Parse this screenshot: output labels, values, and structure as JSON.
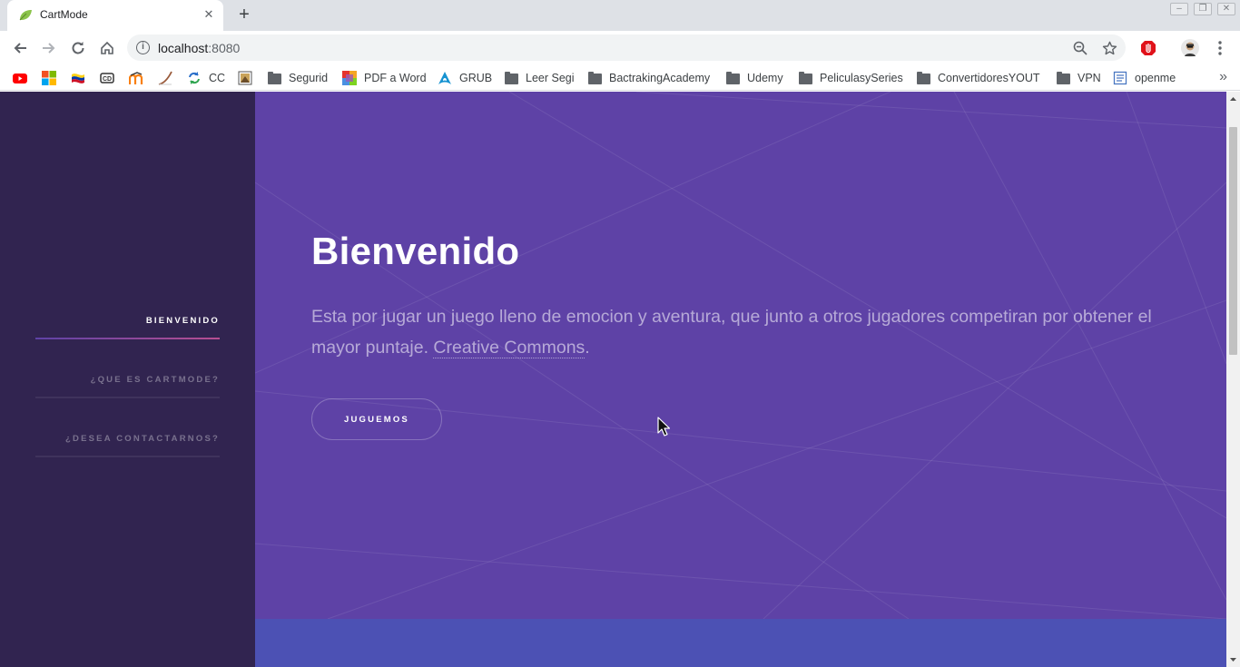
{
  "browser": {
    "tab_title": "CartMode",
    "tab_close": "✕",
    "new_tab": "+",
    "url_host": "localhost",
    "url_port": ":8080",
    "icons": {
      "back": "arrow-left-icon",
      "forward": "arrow-right-icon",
      "reload": "reload-icon",
      "home": "home-icon",
      "zoom": "zoom-icon",
      "star": "star-icon",
      "adblock": "stop-hand-icon",
      "avatar": "avatar-icon",
      "menu": "kebab-menu-icon"
    }
  },
  "bookmarks": {
    "items": [
      {
        "label": "",
        "icon": "youtube-icon"
      },
      {
        "label": "",
        "icon": "microsoft-icon"
      },
      {
        "label": "",
        "icon": "flag-icon"
      },
      {
        "label": "",
        "icon": "cd-icon"
      },
      {
        "label": "",
        "icon": "moodle-icon"
      },
      {
        "label": "",
        "icon": "curve-icon"
      },
      {
        "label": "CC",
        "icon": "sync-icon"
      },
      {
        "label": "",
        "icon": "pdf-icon"
      },
      {
        "label": "Segurid",
        "icon": "folder-icon"
      },
      {
        "label": "PDF a Word",
        "icon": "ilovepdf-icon"
      },
      {
        "label": "GRUB",
        "icon": "arch-icon"
      },
      {
        "label": "Leer Segi",
        "icon": "folder-icon"
      },
      {
        "label": "BactrakingAcademy",
        "icon": "folder-icon"
      },
      {
        "label": "Udemy",
        "icon": "folder-icon"
      },
      {
        "label": "PeliculasySeries",
        "icon": "folder-icon"
      },
      {
        "label": "ConvertidoresYOUT",
        "icon": "folder-icon"
      },
      {
        "label": "VPN",
        "icon": "folder-icon"
      },
      {
        "label": "openme",
        "icon": "document-icon"
      }
    ],
    "more": "»"
  },
  "sidebar": {
    "items": [
      {
        "label": "Bienvenido",
        "active": true
      },
      {
        "label": "¿Que es CartMode?",
        "active": false
      },
      {
        "label": "¿Desea contactarnos?",
        "active": false
      }
    ]
  },
  "hero": {
    "title": "Bienvenido",
    "text": "Esta por jugar un juego lleno de emocion y aventura, que junto a otros jugadores competiran por obtener el mayor puntaje. ",
    "link": "Creative Commons",
    "after_link": ".",
    "button": "Juguemos"
  },
  "colors": {
    "sidebar_bg": "#312450",
    "hero_bg": "#5e42a6",
    "section2_bg": "#4c51b4",
    "accent_start": "#5e42a6",
    "accent_end": "#b74e91"
  }
}
